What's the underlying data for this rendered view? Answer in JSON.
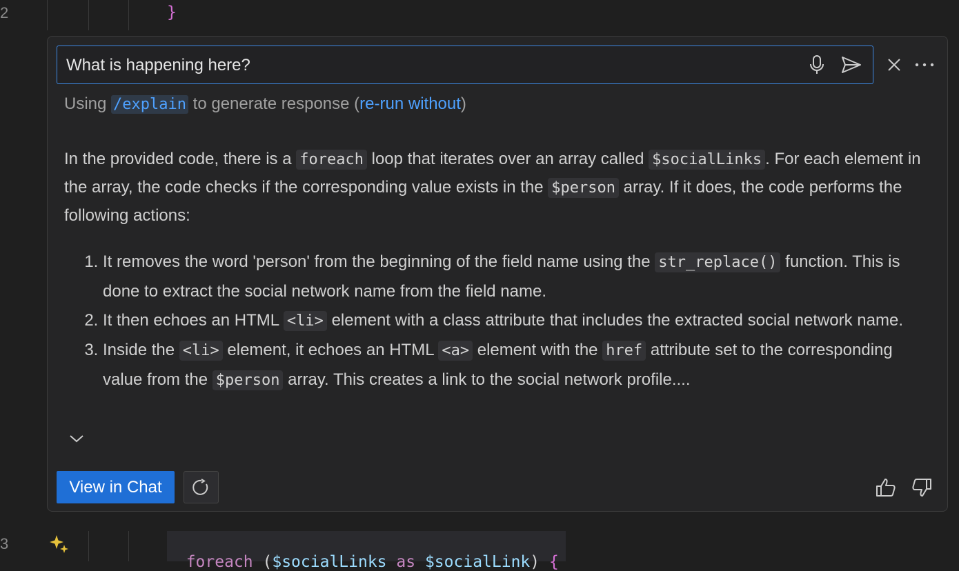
{
  "editor": {
    "line_top_number": "2",
    "line_top_code": "}",
    "line_bottom_number": "3",
    "line_bottom_tokens": {
      "kw": "foreach",
      "open": "(",
      "var1": "$socialLinks",
      "as": "as",
      "var2": "$socialLink",
      "close": ")",
      "brace": "{"
    }
  },
  "inline_chat": {
    "prompt_value": "What is happening here?",
    "usage": {
      "prefix": "Using",
      "command": "/explain",
      "middle": "to generate response (",
      "link": "re-run without",
      "suffix": ")"
    },
    "response": {
      "p1": "In the provided code, there is a",
      "c_foreach": "foreach",
      "p2": "loop that iterates over an array called",
      "c_social": "$socialLinks",
      "p3": ". For each element in the array, the code checks if the corresponding value exists in the",
      "c_person": "$person",
      "p4": "array. If it does, the code performs the following actions:",
      "items": [
        {
          "a": "It removes the word 'person' from the beginning of the field name using the",
          "code": "str_replace()",
          "b": "function. This is done to extract the social network name from the field name."
        },
        {
          "a": "It then echoes an HTML",
          "code": "<li>",
          "b": "element with a class attribute that includes the extracted social network name."
        },
        {
          "a": "Inside the",
          "code1": "<li>",
          "b": "element, it echoes an HTML",
          "code2": "<a>",
          "c": "element with the",
          "code3": "href",
          "d": "attribute set to the corresponding value from the",
          "code4": "$person",
          "e": "array. This creates a link to the social network profile...."
        }
      ]
    },
    "view_in_chat_label": "View in Chat",
    "icons": {
      "mic": "microphone-icon",
      "send": "send-icon",
      "close": "close-icon",
      "more": "more-icon",
      "expand": "chevron-down-icon",
      "rerun": "refresh-icon",
      "thumbs_up": "thumbs-up-icon",
      "thumbs_down": "thumbs-down-icon",
      "sparkle": "sparkle-icon"
    },
    "colors": {
      "accent": "#3e8ae6",
      "button": "#1f6fd6",
      "link": "#4ea1ff"
    }
  }
}
